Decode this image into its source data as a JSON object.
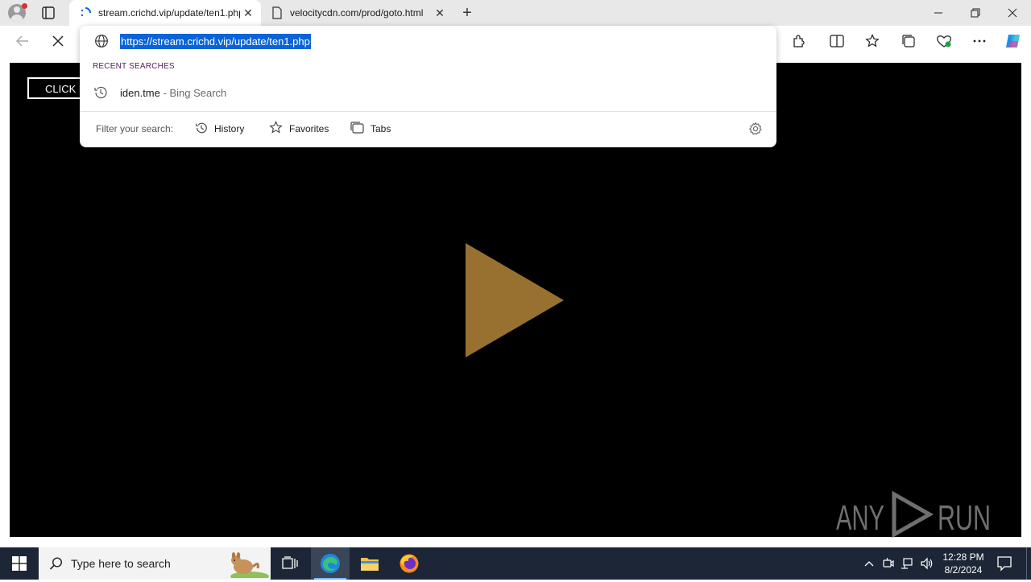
{
  "browser": {
    "tabs": [
      {
        "title": "stream.crichd.vip/update/ten1.php",
        "active": true,
        "favicon": "loading-spinner-icon"
      },
      {
        "title": "velocitycdn.com/prod/goto.html",
        "active": false,
        "favicon": "page-icon"
      }
    ],
    "address_url": "https://stream.crichd.vip/update/ten1.php",
    "dropdown": {
      "section_label": "RECENT SEARCHES",
      "suggestion_query": "iden.tme",
      "suggestion_source": "- Bing Search",
      "filter_label": "Filter your search:",
      "filters": [
        "History",
        "Favorites",
        "Tabs"
      ]
    }
  },
  "page": {
    "click_button_label": "CLICK HERE TO PLAY",
    "play_color": "#987130",
    "watermark": "ANY RUN"
  },
  "taskbar": {
    "search_placeholder": "Type here to search",
    "time": "12:28 PM",
    "date": "8/2/2024"
  },
  "colors": {
    "accent": "#0a64d8",
    "video_bg": "#000000",
    "taskbar_bg": "#1c2636"
  }
}
